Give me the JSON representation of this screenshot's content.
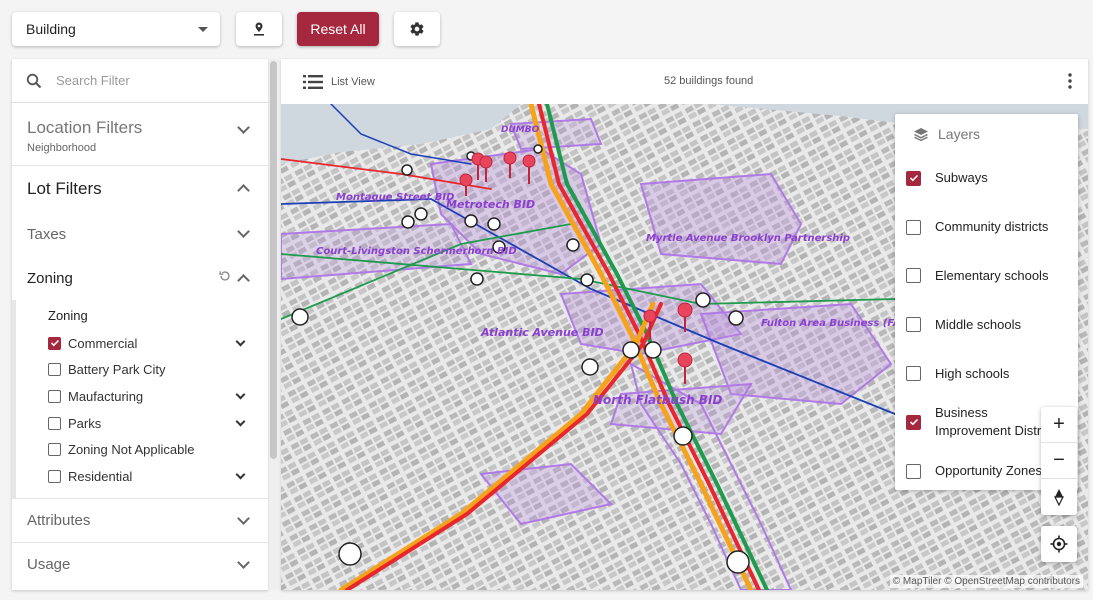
{
  "toolbar": {
    "select_value": "Building",
    "reset_label": "Reset All"
  },
  "sidebar": {
    "search_placeholder": "Search Filter",
    "location": {
      "title": "Location Filters",
      "subtitle": "Neighborhood"
    },
    "lot_filters": "Lot Filters",
    "taxes": "Taxes",
    "zoning": {
      "title": "Zoning",
      "group_label": "Zoning",
      "options": [
        {
          "label": "Commercial",
          "checked": true,
          "expandable": true
        },
        {
          "label": "Battery Park City",
          "checked": false,
          "expandable": false
        },
        {
          "label": "Maufacturing",
          "checked": false,
          "expandable": true
        },
        {
          "label": "Parks",
          "checked": false,
          "expandable": true
        },
        {
          "label": "Zoning Not Applicable",
          "checked": false,
          "expandable": false
        },
        {
          "label": "Residential",
          "checked": false,
          "expandable": true
        }
      ]
    },
    "attributes": "Attributes",
    "usage": "Usage"
  },
  "map": {
    "list_view": "List View",
    "count": "52 buildings found",
    "attribution": "© MapTiler © OpenStreetMap contributors",
    "labels": {
      "metrotech": "Metrotech BID",
      "montague": "Montague Street BID",
      "court": "Court-Livingston Schermerhorn BID",
      "myrtle": "Myrtle Avenue Brooklyn Partnership",
      "atlantic": "Atlantic Avenue BID",
      "fulton": "Fulton Area Business (FAB) Alliance",
      "flatbush": "North Flatbush BID",
      "dumbo": "DUMBO"
    },
    "layers": {
      "title": "Layers",
      "items": [
        {
          "label": "Subways",
          "checked": true
        },
        {
          "label": "Community districts",
          "checked": false
        },
        {
          "label": "Elementary schools",
          "checked": false
        },
        {
          "label": "Middle schools",
          "checked": false
        },
        {
          "label": "High schools",
          "checked": false
        },
        {
          "label": "Business Improvement Distr",
          "checked": true
        },
        {
          "label": "Opportunity Zones",
          "checked": false
        }
      ]
    },
    "controls": {
      "zoom_in": "+",
      "zoom_out": "−"
    }
  },
  "colors": {
    "accent": "#a5283f",
    "bid_outline": "#b07ae6",
    "subway_red": "#e8262c",
    "subway_orange": "#f7a21b",
    "subway_green": "#1e9b4c",
    "subway_blue": "#1b3fb5",
    "pin": "#e8455c"
  }
}
